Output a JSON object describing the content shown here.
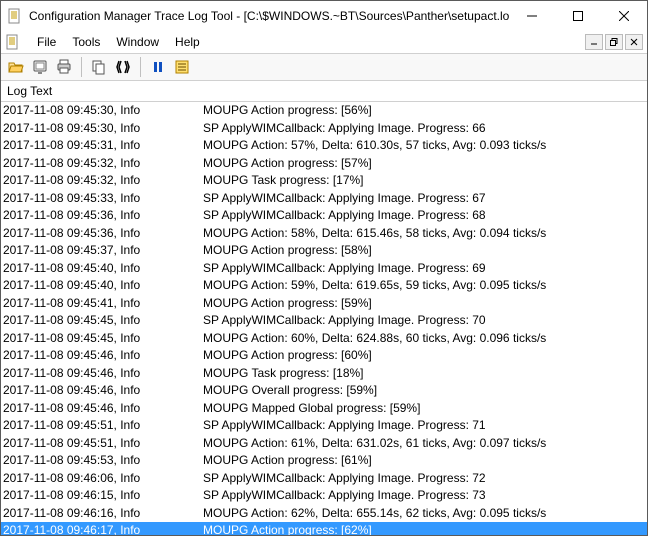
{
  "titlebar": {
    "title": "Configuration Manager Trace Log Tool - [C:\\$WINDOWS.~BT\\Sources\\Panther\\setupact.log]"
  },
  "menu": {
    "file": "File",
    "tools": "Tools",
    "window": "Window",
    "help": "Help"
  },
  "log": {
    "header": "Log Text",
    "rows": [
      {
        "ts": "2017-11-08 09:45:30, Info",
        "msg": "MOUPG  Action progress: [56%]"
      },
      {
        "ts": "2017-11-08 09:45:30, Info",
        "msg": "SP     ApplyWIMCallback: Applying Image. Progress: 66"
      },
      {
        "ts": "2017-11-08 09:45:31, Info",
        "msg": "MOUPG  Action: 57%, Delta: 610.30s, 57 ticks, Avg: 0.093 ticks/s"
      },
      {
        "ts": "2017-11-08 09:45:32, Info",
        "msg": "MOUPG  Action progress: [57%]"
      },
      {
        "ts": "2017-11-08 09:45:32, Info",
        "msg": "MOUPG  Task progress: [17%]"
      },
      {
        "ts": "2017-11-08 09:45:33, Info",
        "msg": "SP     ApplyWIMCallback: Applying Image. Progress: 67"
      },
      {
        "ts": "2017-11-08 09:45:36, Info",
        "msg": "SP     ApplyWIMCallback: Applying Image. Progress: 68"
      },
      {
        "ts": "2017-11-08 09:45:36, Info",
        "msg": "MOUPG  Action: 58%, Delta: 615.46s, 58 ticks, Avg: 0.094 ticks/s"
      },
      {
        "ts": "2017-11-08 09:45:37, Info",
        "msg": "MOUPG  Action progress: [58%]"
      },
      {
        "ts": "2017-11-08 09:45:40, Info",
        "msg": "SP     ApplyWIMCallback: Applying Image. Progress: 69"
      },
      {
        "ts": "2017-11-08 09:45:40, Info",
        "msg": "MOUPG  Action: 59%, Delta: 619.65s, 59 ticks, Avg: 0.095 ticks/s"
      },
      {
        "ts": "2017-11-08 09:45:41, Info",
        "msg": "MOUPG  Action progress: [59%]"
      },
      {
        "ts": "2017-11-08 09:45:45, Info",
        "msg": "SP     ApplyWIMCallback: Applying Image. Progress: 70"
      },
      {
        "ts": "2017-11-08 09:45:45, Info",
        "msg": "MOUPG  Action: 60%, Delta: 624.88s, 60 ticks, Avg: 0.096 ticks/s"
      },
      {
        "ts": "2017-11-08 09:45:46, Info",
        "msg": "MOUPG  Action progress: [60%]"
      },
      {
        "ts": "2017-11-08 09:45:46, Info",
        "msg": "MOUPG  Task progress: [18%]"
      },
      {
        "ts": "2017-11-08 09:45:46, Info",
        "msg": "MOUPG  Overall progress: [59%]"
      },
      {
        "ts": "2017-11-08 09:45:46, Info",
        "msg": "MOUPG  Mapped Global progress: [59%]"
      },
      {
        "ts": "2017-11-08 09:45:51, Info",
        "msg": "SP     ApplyWIMCallback: Applying Image. Progress: 71"
      },
      {
        "ts": "2017-11-08 09:45:51, Info",
        "msg": "MOUPG  Action: 61%, Delta: 631.02s, 61 ticks, Avg: 0.097 ticks/s"
      },
      {
        "ts": "2017-11-08 09:45:53, Info",
        "msg": "MOUPG  Action progress: [61%]"
      },
      {
        "ts": "2017-11-08 09:46:06, Info",
        "msg": "SP     ApplyWIMCallback: Applying Image. Progress: 72"
      },
      {
        "ts": "2017-11-08 09:46:15, Info",
        "msg": "SP     ApplyWIMCallback: Applying Image. Progress: 73"
      },
      {
        "ts": "2017-11-08 09:46:16, Info",
        "msg": "MOUPG  Action: 62%, Delta: 655.14s, 62 ticks, Avg: 0.095 ticks/s"
      },
      {
        "ts": "2017-11-08 09:46:17, Info",
        "msg": "MOUPG  Action progress: [62%]",
        "selected": true
      }
    ]
  }
}
